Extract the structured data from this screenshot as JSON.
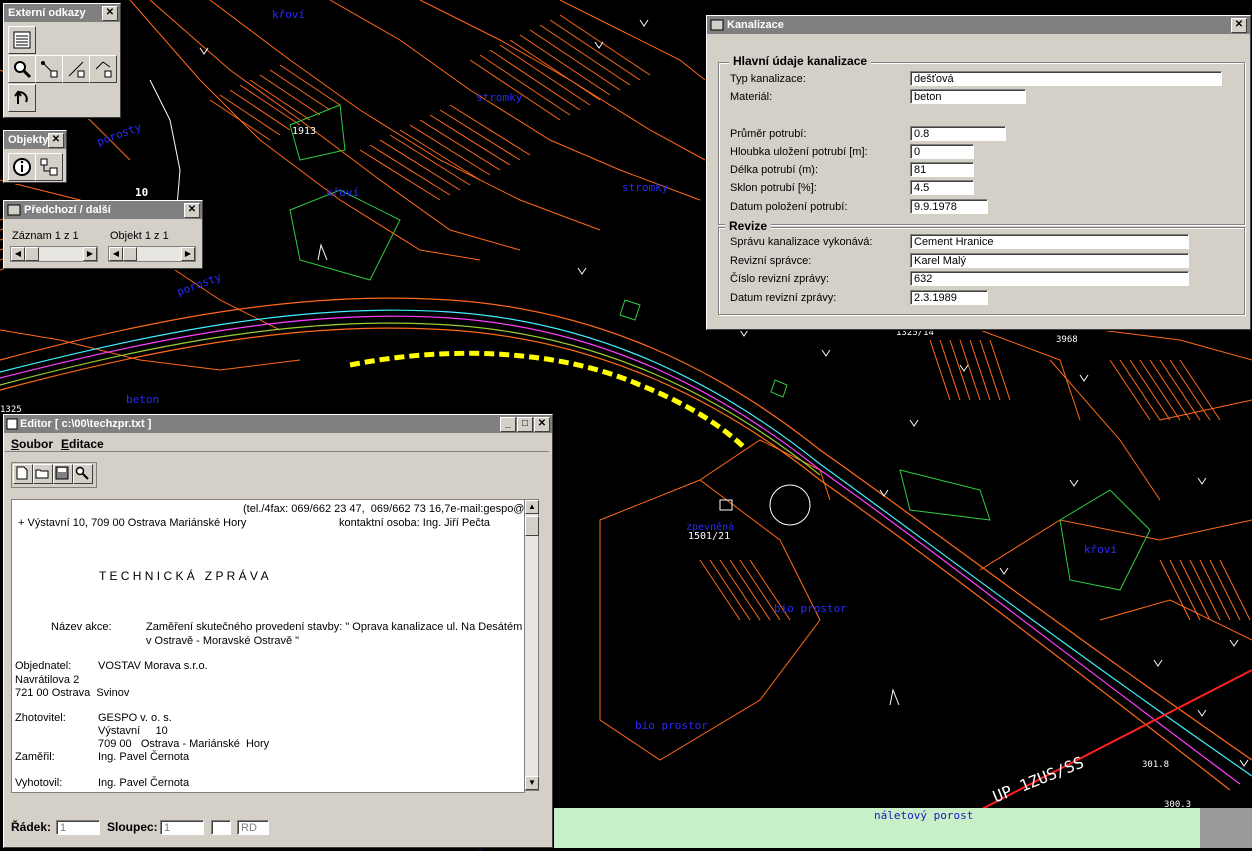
{
  "map_labels": {
    "krovi_1": "křoví",
    "stromky_1": "stromky",
    "porosty_1": "porosty",
    "building_1913": "1913",
    "krovi_2": "křoví",
    "stromky_2": "stromky",
    "num_10": "10",
    "porosty_2": "porosty",
    "beton": "beton",
    "num_1325": "1325",
    "num_1325_14": "1325/14",
    "num_3968": "3968",
    "krovi_3": "křoví",
    "parcel_1501": "1501/21",
    "zpevnena": "zpevněná",
    "bez_prostor_1": "bio prostor",
    "bez_prostor_2": "bio prostor",
    "bez_prostor_3": "bio prostor",
    "naletovy": "náletový porost",
    "street": "UP 1ZUS/SS",
    "elev_1": "301.8",
    "elev_2": "300.3"
  },
  "externi": {
    "title": "Externí odkazy"
  },
  "objekty": {
    "title": "Objekty"
  },
  "predchozi": {
    "title": "Předchozí / další",
    "zaznam": "Záznam 1 z 1",
    "objekt": "Objekt 1 z 1"
  },
  "kanalizace": {
    "title": "Kanalizace",
    "group_main": "Hlavní údaje kanalizace",
    "group_revize": "Revize",
    "fields": [
      {
        "label": "Typ kanalizace:",
        "value": "dešťová"
      },
      {
        "label": "Materiál:",
        "value": "beton"
      },
      {
        "label": "Průměr potrubí:",
        "value": "0.8"
      },
      {
        "label": "Hloubka uložení potrubí [m]:",
        "value": "0"
      },
      {
        "label": "Délka potrubí (m):",
        "value": "81"
      },
      {
        "label": "Sklon potrubí [%]:",
        "value": "4.5"
      },
      {
        "label": "Datum položení potrubí:",
        "value": "9.9.1978"
      },
      {
        "label": "Správu kanalizace vykonává:",
        "value": "Cement Hranice"
      },
      {
        "label": "Revizní správce:",
        "value": "Karel Malý"
      },
      {
        "label": "Číslo revizní zprávy:",
        "value": "632"
      },
      {
        "label": "Datum revizní zprávy:",
        "value": "2.3.1989"
      }
    ]
  },
  "editor": {
    "title": "Editor [ c:\\00\\techzpr.txt ]",
    "menu_soubor_key": "S",
    "menu_soubor_rest": "oubor",
    "menu_editace_key": "E",
    "menu_editace_rest": "ditace",
    "lines": [
      "(tel./4fax: 069/662 23 47,  069/662 73 16,7e-mail:gespo@",
      "+ Výstavní 10, 709 00 Ostrava Mariánské Hory",
      "kontaktní osoba: Ing. Jiří Pečta",
      "T E C H N I C K Á   Z P R Á V A",
      "Název akce:",
      "Zaměření skutečného provedení stavby: \" Oprava kanalizace ul. Na Desátém",
      "v Ostravě - Moravské Ostravě \"",
      "Objednatel:",
      "VOSTAV Morava s.r.o.",
      "Navrátilova 2",
      "721 00 Ostrava  Svinov",
      "Zhotovitel:",
      "GESPO v. o. s.",
      "Výstavní     10",
      "709 00   Ostrava - Mariánské  Hory",
      "Zaměřil:",
      "Ing. Pavel Černota",
      "Vyhotovil:",
      "Ing. Pavel Černota"
    ],
    "status_radek": "Řádek:",
    "status_radek_val": "1",
    "status_sloupec": "Sloupec:",
    "status_sloupec_val": "1",
    "status_blank": "",
    "status_rd": "RD"
  }
}
